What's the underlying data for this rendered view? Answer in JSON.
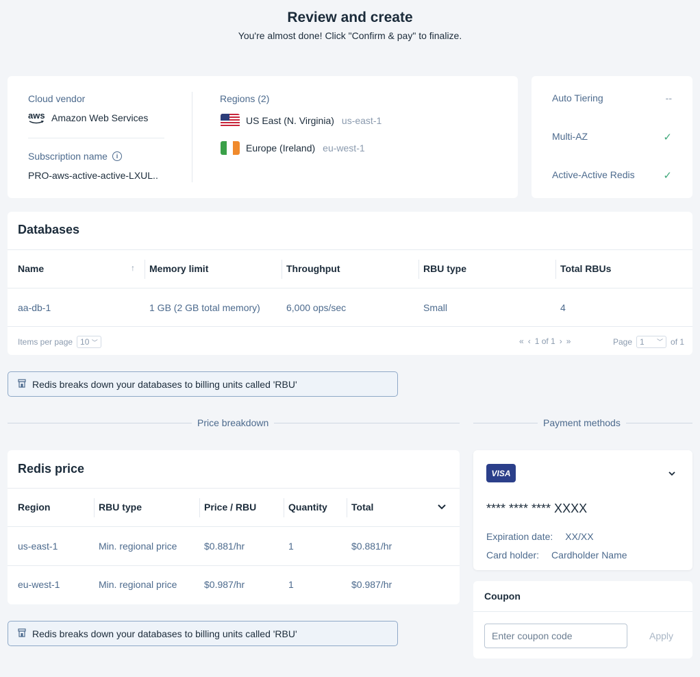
{
  "header": {
    "title": "Review and create",
    "subtitle": "You're almost done! Click \"Confirm & pay\" to finalize."
  },
  "summary": {
    "cloud_vendor_label": "Cloud vendor",
    "cloud_vendor_logo": "aws",
    "cloud_vendor_name": "Amazon Web Services",
    "subscription_name_label": "Subscription name",
    "subscription_name": "PRO-aws-active-active-LXUL..",
    "regions_label": "Regions (2)",
    "regions": [
      {
        "name": "US East (N. Virginia)",
        "code": "us-east-1",
        "flag": "us-flag-icon"
      },
      {
        "name": "Europe (Ireland)",
        "code": "eu-west-1",
        "flag": "ireland-flag-icon"
      }
    ]
  },
  "features": [
    {
      "label": "Auto Tiering",
      "value": "--"
    },
    {
      "label": "Multi-AZ",
      "value": "✓"
    },
    {
      "label": "Active-Active Redis",
      "value": "✓"
    }
  ],
  "databases": {
    "title": "Databases",
    "columns": [
      "Name",
      "Memory limit",
      "Throughput",
      "RBU type",
      "Total RBUs"
    ],
    "rows": [
      [
        "aa-db-1",
        "1 GB (2 GB total memory)",
        "6,000 ops/sec",
        "Small",
        "4"
      ]
    ],
    "pagination": {
      "items_per_page_label": "Items per page",
      "items_per_page": "10",
      "range": "1 of 1",
      "page_label": "Page",
      "page": "1",
      "of_label": "of 1"
    }
  },
  "info_banner": "Redis breaks down your databases to billing units called 'RBU'",
  "price_breakdown_label": "Price breakdown",
  "payment_methods_label": "Payment methods",
  "redis_price": {
    "title": "Redis price",
    "columns": [
      "Region",
      "RBU type",
      "Price / RBU",
      "Quantity",
      "Total"
    ],
    "rows": [
      [
        "us-east-1",
        "Min. regional price",
        "$0.881/hr",
        "1",
        "$0.881/hr"
      ],
      [
        "eu-west-1",
        "Min. regional price",
        "$0.987/hr",
        "1",
        "$0.987/hr"
      ]
    ]
  },
  "info_banner_2": "Redis breaks down your databases to billing units called 'RBU'",
  "payment": {
    "card_brand": "VISA",
    "card_number": "**** **** **** XXXX",
    "expiration_label": "Expiration date:",
    "expiration": "XX/XX",
    "holder_label": "Card holder:",
    "holder": "Cardholder Name"
  },
  "coupon": {
    "title": "Coupon",
    "placeholder": "Enter coupon code",
    "apply_label": "Apply"
  },
  "colors": {
    "background": "#f3f5f8",
    "link": "#4c6a8d",
    "check": "#3fa87a",
    "visa": "#2b3f8a"
  }
}
